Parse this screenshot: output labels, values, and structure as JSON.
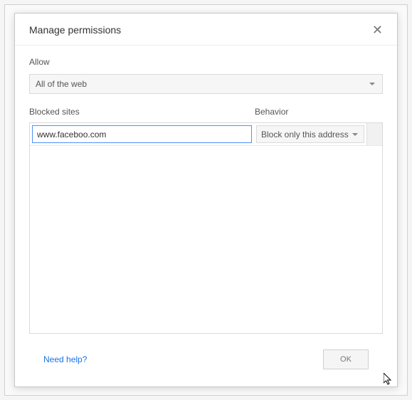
{
  "dialog": {
    "title": "Manage permissions"
  },
  "allow": {
    "label": "Allow",
    "selected": "All of the web"
  },
  "columns": {
    "sites": "Blocked sites",
    "behavior": "Behavior"
  },
  "rows": [
    {
      "site": "www.faceboo.com",
      "behavior": "Block only this address"
    }
  ],
  "footer": {
    "help": "Need help?",
    "ok": "OK"
  }
}
